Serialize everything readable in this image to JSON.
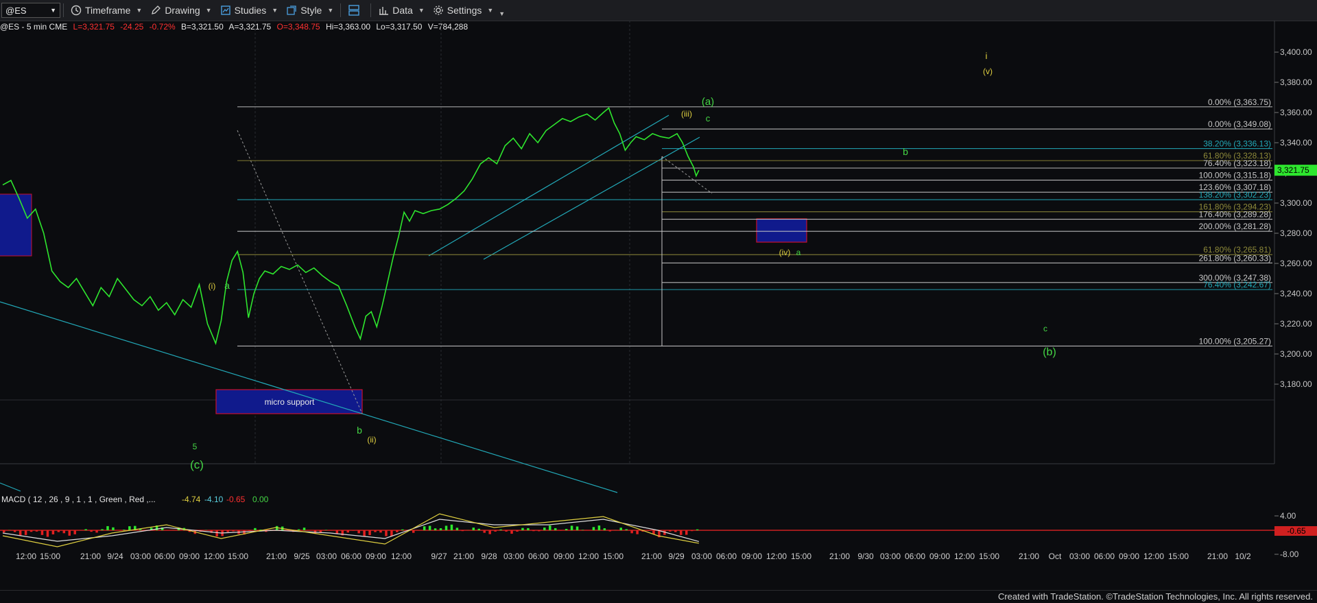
{
  "toolbar": {
    "symbol": "@ES",
    "items": [
      {
        "id": "timeframe",
        "label": "Timeframe",
        "icon": "clock-icon"
      },
      {
        "id": "drawing",
        "label": "Drawing",
        "icon": "pencil-icon"
      },
      {
        "id": "studies",
        "label": "Studies",
        "icon": "studies-icon"
      },
      {
        "id": "style",
        "label": "Style",
        "icon": "style-icon"
      },
      {
        "id": "data",
        "label": "Data",
        "icon": "data-icon"
      },
      {
        "id": "settings",
        "label": "Settings",
        "icon": "gear-icon"
      }
    ]
  },
  "quote": {
    "name": "@ES - 5 min  CME",
    "last": "L=3,321.75",
    "change": "-24.25",
    "pct": "-0.72%",
    "bid": "B=3,321.50",
    "ask": "A=3,321.75",
    "open": "O=3,348.75",
    "high": "Hi=3,363.00",
    "low": "Lo=3,317.50",
    "volume": "V=784,288"
  },
  "footer": "Created with TradeStation. ©TradeStation Technologies, Inc. All rights reserved.",
  "colors": {
    "price": "#2ee62e",
    "grid": "#2a2c31",
    "label_bg": "#2ee62e",
    "fib_gray": "#c8c8c8",
    "fib_teal": "#22a9b8",
    "fib_olive": "#8f8b3a",
    "support_box": "#101a8c",
    "support_border": "#c8102e"
  },
  "chart_data": [
    {
      "type": "line",
      "title": "@ES - 5 min",
      "y_axis": {
        "ylim": [
          3170,
          3415
        ],
        "ticks": [
          "3,400.00",
          "3,380.00",
          "3,360.00",
          "3,340.00",
          "3,320.00",
          "3,300.00",
          "3,280.00",
          "3,260.00",
          "3,240.00",
          "3,220.00",
          "3,200.00",
          "3,180.00"
        ]
      },
      "x_ticks": [
        "12:00",
        "15:00",
        "21:00",
        "9/24",
        "03:00",
        "06:00",
        "09:00",
        "12:00",
        "15:00",
        "21:00",
        "9/25",
        "03:00",
        "06:00",
        "09:00",
        "12:00",
        "9/27",
        "21:00",
        "9/28",
        "03:00",
        "06:00",
        "09:00",
        "12:00",
        "15:00",
        "21:00",
        "9/29",
        "03:00",
        "06:00",
        "09:00",
        "12:00",
        "15:00",
        "21:00",
        "9/30",
        "03:00",
        "06:00",
        "09:00",
        "12:00",
        "15:00",
        "21:00",
        "Oct",
        "03:00",
        "06:00",
        "09:00",
        "12:00",
        "15:00",
        "21:00",
        "10/2"
      ],
      "series": [
        {
          "name": "Price",
          "points": [
            [
              0,
              3312
            ],
            [
              3,
              3315
            ],
            [
              6,
              3303
            ],
            [
              9,
              3290
            ],
            [
              12,
              3296
            ],
            [
              15,
              3280
            ],
            [
              18,
              3255
            ],
            [
              21,
              3248
            ],
            [
              24,
              3244
            ],
            [
              27,
              3250
            ],
            [
              30,
              3241
            ],
            [
              33,
              3232
            ],
            [
              36,
              3244
            ],
            [
              39,
              3238
            ],
            [
              42,
              3250
            ],
            [
              45,
              3243
            ],
            [
              48,
              3236
            ],
            [
              51,
              3232
            ],
            [
              54,
              3238
            ],
            [
              57,
              3229
            ],
            [
              60,
              3234
            ],
            [
              63,
              3226
            ],
            [
              66,
              3236
            ],
            [
              69,
              3231
            ],
            [
              72,
              3246
            ],
            [
              75,
              3220
            ],
            [
              78,
              3207
            ],
            [
              80,
              3222
            ],
            [
              82,
              3248
            ],
            [
              84,
              3262
            ],
            [
              86,
              3268
            ],
            [
              88,
              3254
            ],
            [
              90,
              3224
            ],
            [
              92,
              3240
            ],
            [
              94,
              3250
            ],
            [
              96,
              3255
            ],
            [
              99,
              3253
            ],
            [
              102,
              3258
            ],
            [
              105,
              3256
            ],
            [
              108,
              3259
            ],
            [
              111,
              3254
            ],
            [
              114,
              3257
            ],
            [
              117,
              3252
            ],
            [
              120,
              3248
            ],
            [
              123,
              3245
            ],
            [
              126,
              3232
            ],
            [
              129,
              3218
            ],
            [
              131,
              3210
            ],
            [
              133,
              3225
            ],
            [
              135,
              3228
            ],
            [
              137,
              3218
            ],
            [
              139,
              3232
            ],
            [
              141,
              3248
            ],
            [
              143,
              3264
            ],
            [
              145,
              3278
            ],
            [
              147,
              3294
            ],
            [
              149,
              3288
            ],
            [
              151,
              3295
            ],
            [
              154,
              3293
            ],
            [
              157,
              3295
            ],
            [
              160,
              3296
            ],
            [
              163,
              3299
            ],
            [
              166,
              3303
            ],
            [
              169,
              3308
            ],
            [
              172,
              3316
            ],
            [
              175,
              3326
            ],
            [
              178,
              3330
            ],
            [
              181,
              3326
            ],
            [
              184,
              3338
            ],
            [
              187,
              3343
            ],
            [
              190,
              3336
            ],
            [
              193,
              3346
            ],
            [
              196,
              3340
            ],
            [
              199,
              3348
            ],
            [
              202,
              3352
            ],
            [
              205,
              3356
            ],
            [
              208,
              3354
            ],
            [
              211,
              3357
            ],
            [
              214,
              3359
            ],
            [
              217,
              3355
            ],
            [
              220,
              3360
            ],
            [
              222,
              3363
            ],
            [
              224,
              3353
            ],
            [
              226,
              3346
            ],
            [
              228,
              3335
            ],
            [
              230,
              3340
            ],
            [
              232,
              3344
            ],
            [
              235,
              3342
            ],
            [
              238,
              3346
            ],
            [
              241,
              3344
            ],
            [
              244,
              3343
            ],
            [
              247,
              3346
            ],
            [
              249,
              3340
            ],
            [
              251,
              3331
            ],
            [
              253,
              3324
            ],
            [
              254,
              3318
            ],
            [
              255,
              3321.75
            ]
          ]
        }
      ]
    },
    {
      "type": "line",
      "title": "MACD ( 12 , 26 , 9 , 1 , 1 , Green , Red ,...",
      "values_text": [
        "-4.74",
        "-4.10",
        "-0.65",
        "0.00"
      ],
      "y_axis": {
        "ticks": [
          "4.00",
          "-8.00"
        ],
        "current": "-0.65"
      },
      "series": [
        {
          "name": "MACD",
          "points": [
            [
              0,
              -2
            ],
            [
              20,
              -6
            ],
            [
              40,
              -1
            ],
            [
              60,
              2
            ],
            [
              80,
              -3
            ],
            [
              100,
              1
            ],
            [
              120,
              -2
            ],
            [
              140,
              -5
            ],
            [
              160,
              6
            ],
            [
              180,
              1
            ],
            [
              200,
              3
            ],
            [
              220,
              5
            ],
            [
              240,
              -2
            ],
            [
              255,
              -4.74
            ]
          ]
        },
        {
          "name": "Signal",
          "points": [
            [
              0,
              -1
            ],
            [
              20,
              -4
            ],
            [
              40,
              -2
            ],
            [
              60,
              1
            ],
            [
              80,
              -1
            ],
            [
              100,
              0
            ],
            [
              120,
              -1
            ],
            [
              140,
              -3
            ],
            [
              160,
              4
            ],
            [
              180,
              2
            ],
            [
              200,
              2
            ],
            [
              220,
              4
            ],
            [
              240,
              0
            ],
            [
              255,
              -4.1
            ]
          ]
        }
      ]
    }
  ],
  "annotations": {
    "fib_labels": [
      {
        "text": "0.00% (3,363.75)",
        "price": 3363.75,
        "color": "gray"
      },
      {
        "text": "0.00% (3,349.08)",
        "price": 3349.08,
        "color": "gray"
      },
      {
        "text": "38.20% (3,336.13)",
        "price": 3336.13,
        "color": "teal"
      },
      {
        "text": "61.80% (3,328.13)",
        "price": 3328.13,
        "color": "olive"
      },
      {
        "text": "76.40% (3,323.18)",
        "price": 3323.18,
        "color": "gray"
      },
      {
        "text": "100.00% (3,315.18)",
        "price": 3315.18,
        "color": "gray"
      },
      {
        "text": "123.60% (3,307.18)",
        "price": 3307.18,
        "color": "gray"
      },
      {
        "text": "138.20% (3,302.23)",
        "price": 3302.23,
        "color": "teal"
      },
      {
        "text": "161.80% (3,294.23)",
        "price": 3294.23,
        "color": "olive"
      },
      {
        "text": "176.40% (3,289.28)",
        "price": 3289.28,
        "color": "gray"
      },
      {
        "text": "200.00% (3,281.28)",
        "price": 3281.28,
        "color": "gray"
      },
      {
        "text": "61.80% (3,265.81)",
        "price": 3265.81,
        "color": "olive"
      },
      {
        "text": "261.80% (3,260.33)",
        "price": 3260.33,
        "color": "gray"
      },
      {
        "text": "300.00% (3,247.38)",
        "price": 3247.38,
        "color": "gray"
      },
      {
        "text": "76.40% (3,242.67)",
        "price": 3242.67,
        "color": "teal"
      },
      {
        "text": "100.00% (3,205.27)",
        "price": 3205.27,
        "color": "gray"
      }
    ],
    "wave_labels": [
      {
        "text": "(iii)",
        "color": "yellow"
      },
      {
        "text": "(a)",
        "color": "green"
      },
      {
        "text": "c",
        "color": "green"
      },
      {
        "text": "i",
        "color": "yellow"
      },
      {
        "text": "(v)",
        "color": "yellow"
      },
      {
        "text": "b",
        "color": "green"
      },
      {
        "text": "(iv)",
        "color": "yellow"
      },
      {
        "text": "a",
        "color": "green"
      },
      {
        "text": "(i)",
        "color": "yellow"
      },
      {
        "text": "a",
        "color": "green"
      },
      {
        "text": "5",
        "color": "green"
      },
      {
        "text": "(c)",
        "color": "green"
      },
      {
        "text": "b",
        "color": "green"
      },
      {
        "text": "(ii)",
        "color": "yellow"
      },
      {
        "text": "c",
        "color": "green"
      },
      {
        "text": "(b)",
        "color": "green"
      }
    ],
    "support_label": "micro support",
    "current_price": "3,321.75"
  }
}
